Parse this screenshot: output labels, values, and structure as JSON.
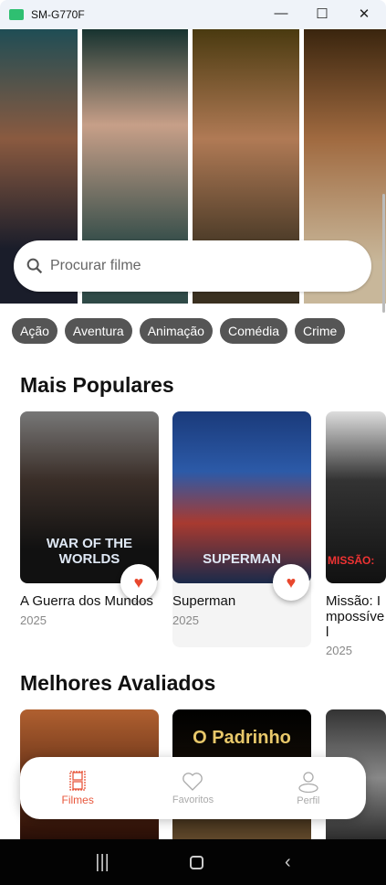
{
  "window": {
    "title": "SM-G770F"
  },
  "search": {
    "placeholder": "Procurar filme"
  },
  "genres": [
    "Ação",
    "Aventura",
    "Animação",
    "Comédia",
    "Crime"
  ],
  "sections": {
    "popular": "Mais Populares",
    "top_rated": "Melhores Avaliados"
  },
  "popular": [
    {
      "title": "A Guerra dos Mundos",
      "year": "2025",
      "logo": "WAR OF THE WORLDS"
    },
    {
      "title": "Superman",
      "year": "2025",
      "logo": "SUPERMAN"
    },
    {
      "title": "Missão: Impossível",
      "year": "2025",
      "logo": "MISSÃO:"
    }
  ],
  "top_rated": [
    {
      "logo": ""
    },
    {
      "logo": "O Padrinho"
    },
    {
      "logo": ""
    }
  ],
  "nav": [
    {
      "label": "Filmes",
      "active": true
    },
    {
      "label": "Favoritos"
    },
    {
      "label": "Perfil"
    }
  ],
  "colors": {
    "accent": "#e8583d",
    "chip": "#555555"
  }
}
